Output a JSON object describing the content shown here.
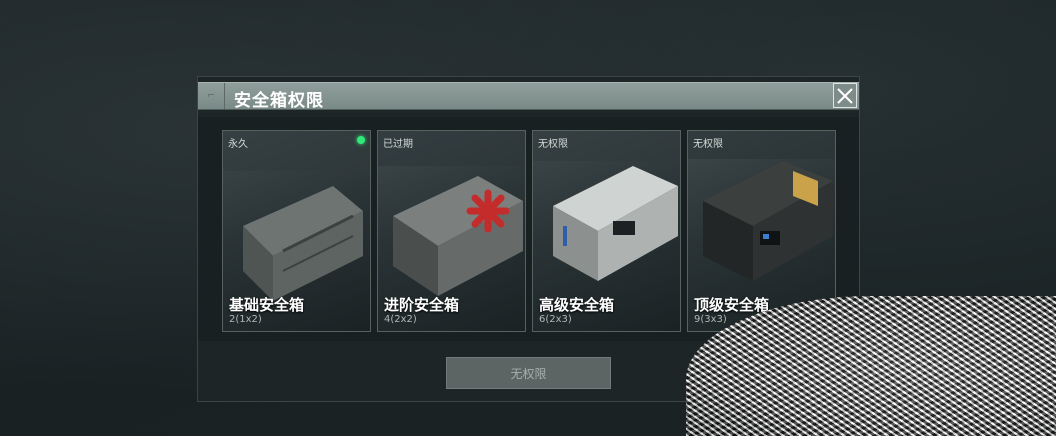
{
  "dialog": {
    "title": "安全箱权限",
    "button_label": "无权限"
  },
  "cards": [
    {
      "status": "永久",
      "name": "基础安全箱",
      "size": "2(1x2)",
      "active": true
    },
    {
      "status": "已过期",
      "name": "进阶安全箱",
      "size": "4(2x2)",
      "active": false
    },
    {
      "status": "无权限",
      "name": "高级安全箱",
      "size": "6(2x3)",
      "active": false
    },
    {
      "status": "无权限",
      "name": "顶级安全箱",
      "size": "9(3x3)",
      "active": false
    }
  ],
  "colors": {
    "title_bar": "#8a9996",
    "active_dot": "#2ee87a",
    "button_bg": "#5c6563"
  }
}
